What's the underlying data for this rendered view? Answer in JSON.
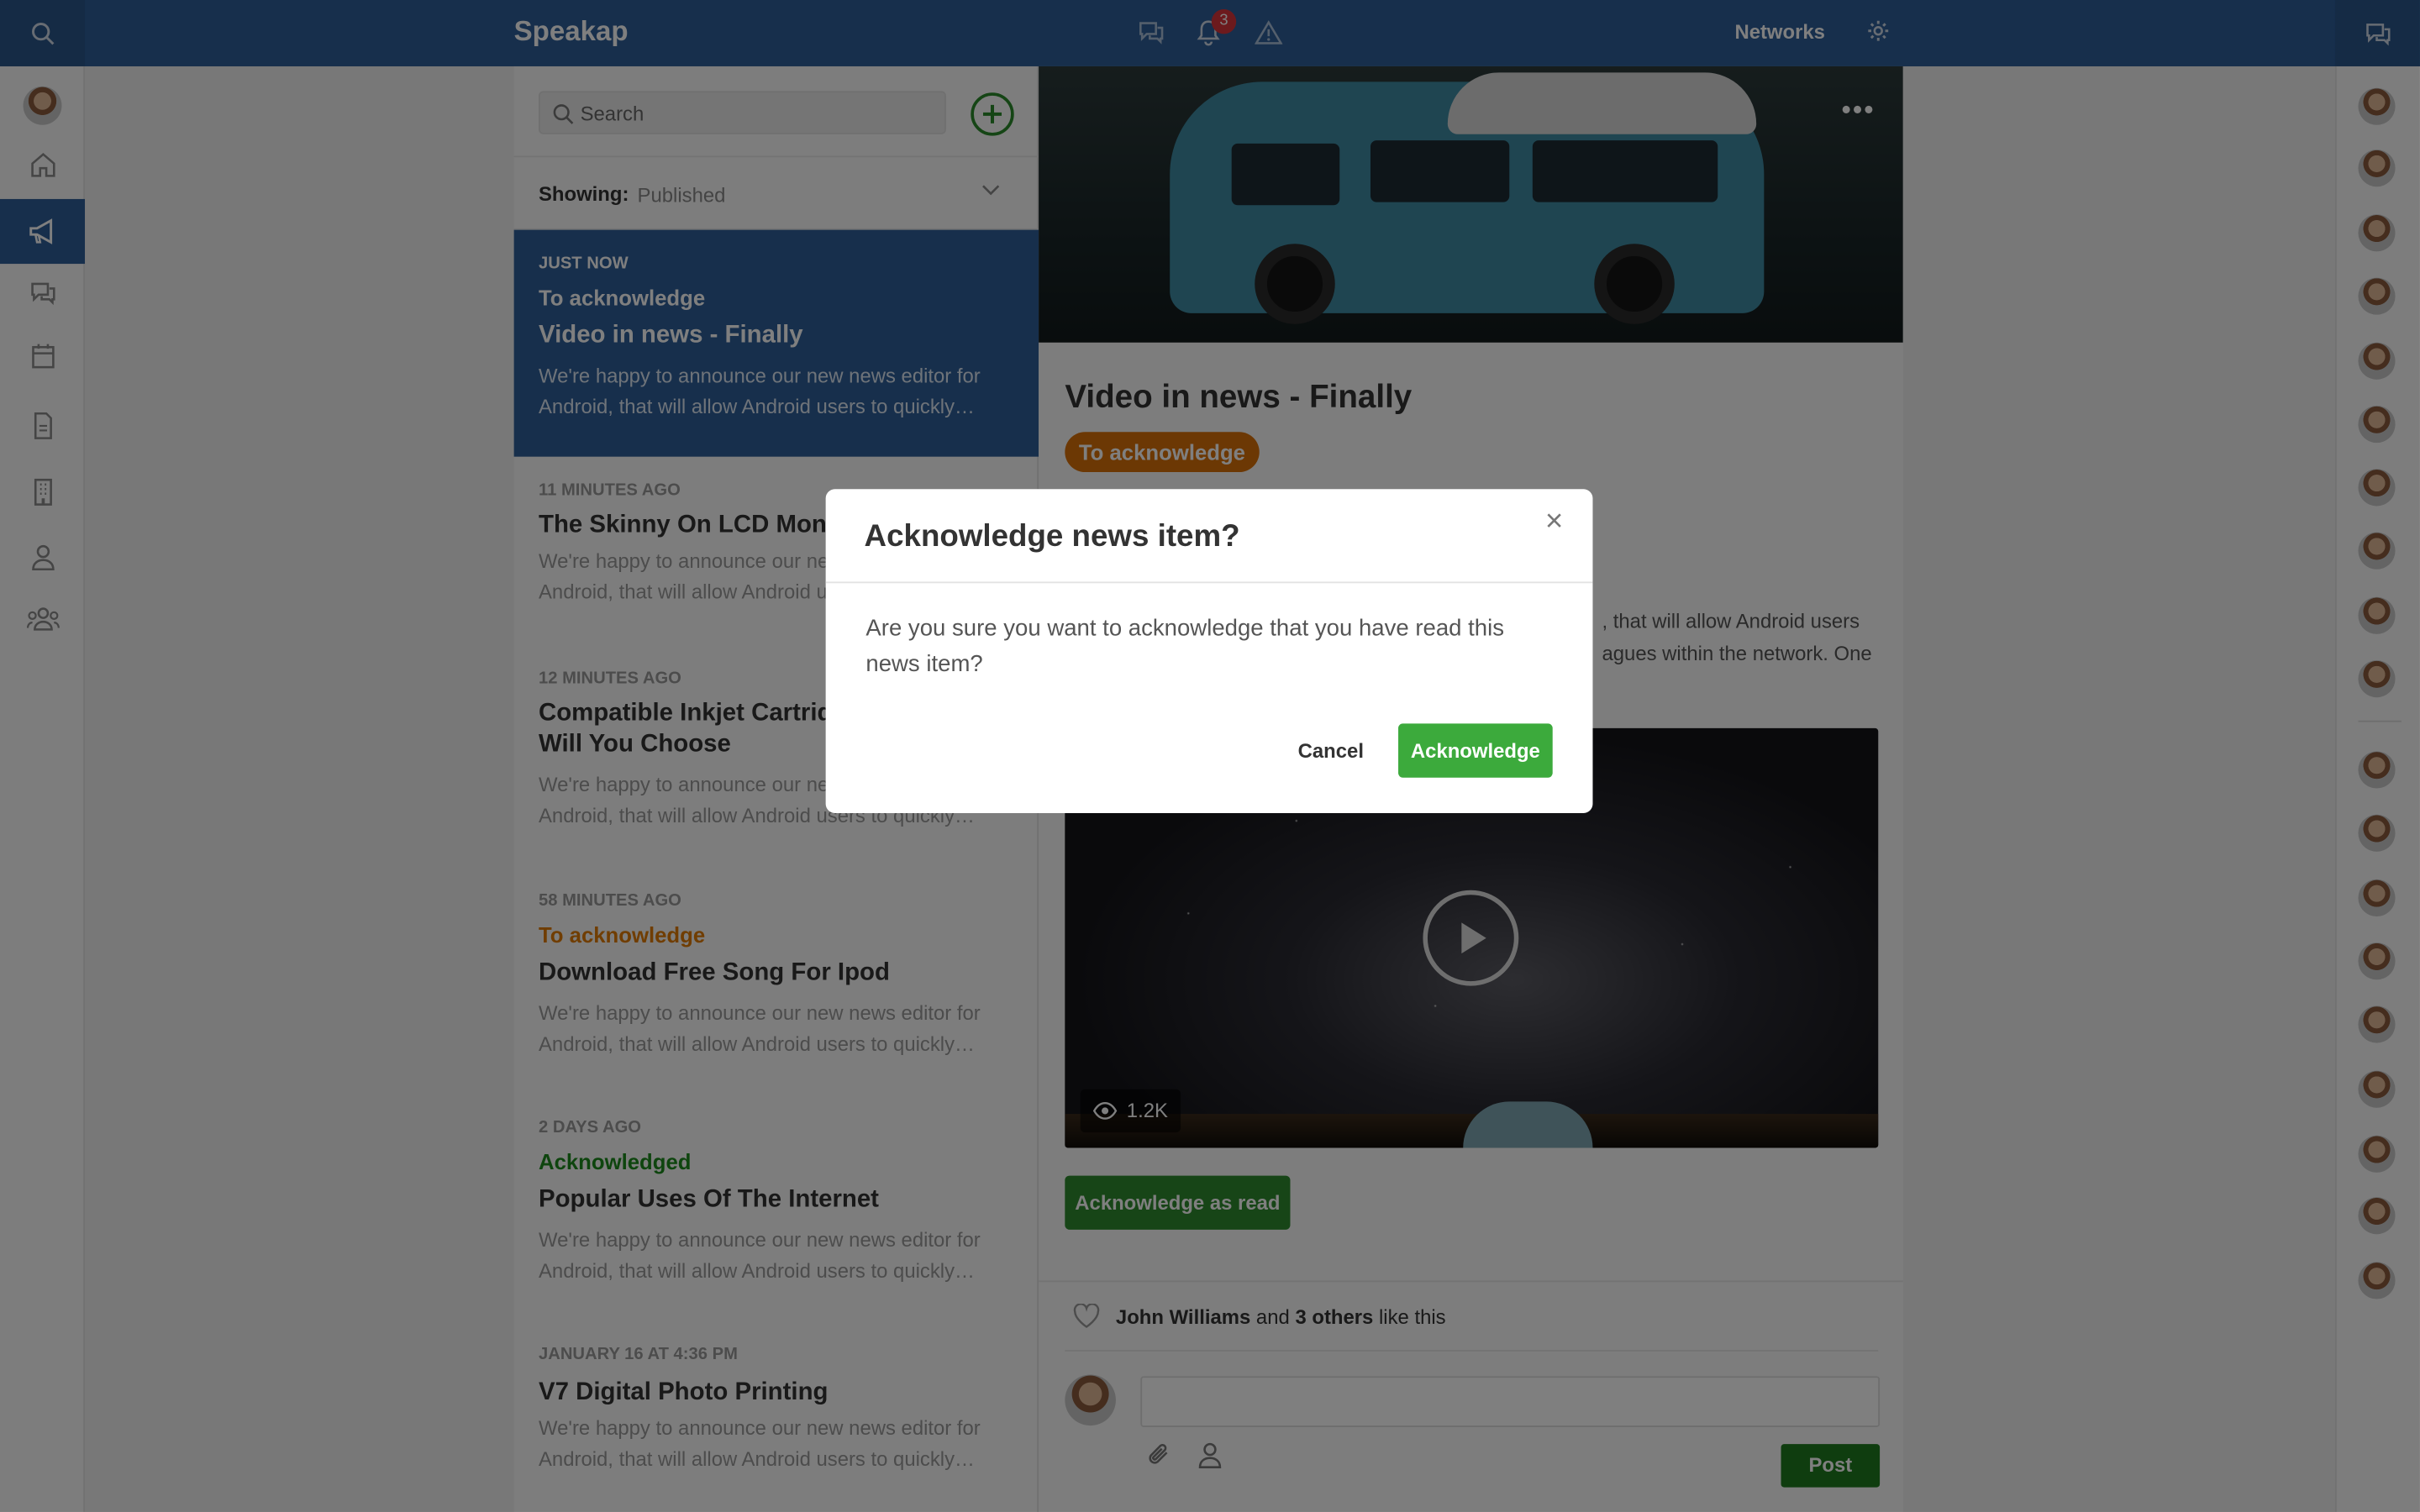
{
  "app": {
    "name": "Speakap",
    "notification_count": "3",
    "networks_label": "Networks"
  },
  "sidebar": {
    "items": [
      {
        "icon": "home-icon"
      },
      {
        "icon": "megaphone-icon",
        "active": true
      },
      {
        "icon": "chat-icon"
      },
      {
        "icon": "calendar-icon"
      },
      {
        "icon": "document-icon"
      },
      {
        "icon": "building-icon"
      },
      {
        "icon": "person-icon"
      },
      {
        "icon": "group-icon"
      }
    ]
  },
  "news_list": {
    "search_placeholder": "Search",
    "showing_label": "Showing:",
    "showing_value": "Published",
    "items": [
      {
        "time": "JUST NOW",
        "status": "To acknowledge",
        "title": "Video in news - Finally",
        "desc": "We're happy to announce our new news editor for Android, that will allow Android users to quickly…",
        "active": true
      },
      {
        "time": "11 MINUTES AGO",
        "status": "",
        "title": "The Skinny On LCD Monitors",
        "desc": "We're happy to announce our new news editor for Android, that will allow Android users to quickly…"
      },
      {
        "time": "12 MINUTES AGO",
        "status": "",
        "title": "Compatible Inkjet Cartridge Which One Will You Choose",
        "desc": "We're happy to announce our new news editor for Android, that will allow Android users to quickly…"
      },
      {
        "time": "58 MINUTES AGO",
        "status": "To acknowledge",
        "title": "Download Free Song For Ipod",
        "desc": "We're happy to announce our new news editor for Android, that will allow Android users to quickly…"
      },
      {
        "time": "2 DAYS AGO",
        "status": "Acknowledged",
        "title": "Popular Uses Of The Internet",
        "desc": "We're happy to announce our new news editor for Android, that will allow Android users to quickly…"
      },
      {
        "time": "JANUARY 16 AT 4:36 PM",
        "status": "",
        "title": "V7 Digital Photo Printing",
        "desc": "We're happy to announce our new news editor for Android, that will allow Android users to quickly…"
      }
    ]
  },
  "article": {
    "title": "Video in news - Finally",
    "tag": "To acknowledge",
    "body_line1": ", that will allow Android users",
    "body_line2": "agues within the network. One",
    "video_views": "1.2K",
    "ack_button": "Acknowledge as read",
    "likes_name": "John Williams",
    "likes_and": "and",
    "likes_others": "3 others",
    "likes_suffix": "like this",
    "post_button": "Post"
  },
  "modal": {
    "title": "Acknowledge news item?",
    "close": "×",
    "text": "Are you sure you want to acknowledge that you have read this news item?",
    "cancel": "Cancel",
    "confirm": "Acknowledge"
  },
  "colors": {
    "brand": "#2e5f99",
    "accent_green": "#3caa3c",
    "tag_orange": "#d97008",
    "badge_red": "#d9353a"
  }
}
